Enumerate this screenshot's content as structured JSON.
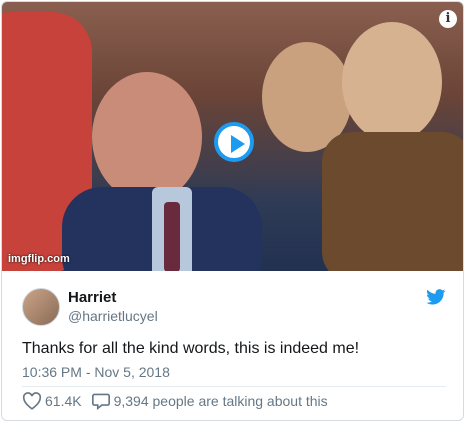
{
  "media": {
    "watermark": "imgflip.com",
    "info_symbol": "i",
    "play_icon": "play-icon"
  },
  "tweet": {
    "author_name": "Harriet",
    "author_handle": "@harrietlucyel",
    "text": "Thanks for all the kind words, this is indeed me!",
    "timestamp": "10:36 PM - Nov 5, 2018",
    "likes": "61.4K",
    "talking": "9,394 people are talking about this"
  },
  "colors": {
    "accent": "#1d9bf0",
    "muted": "#657786"
  }
}
